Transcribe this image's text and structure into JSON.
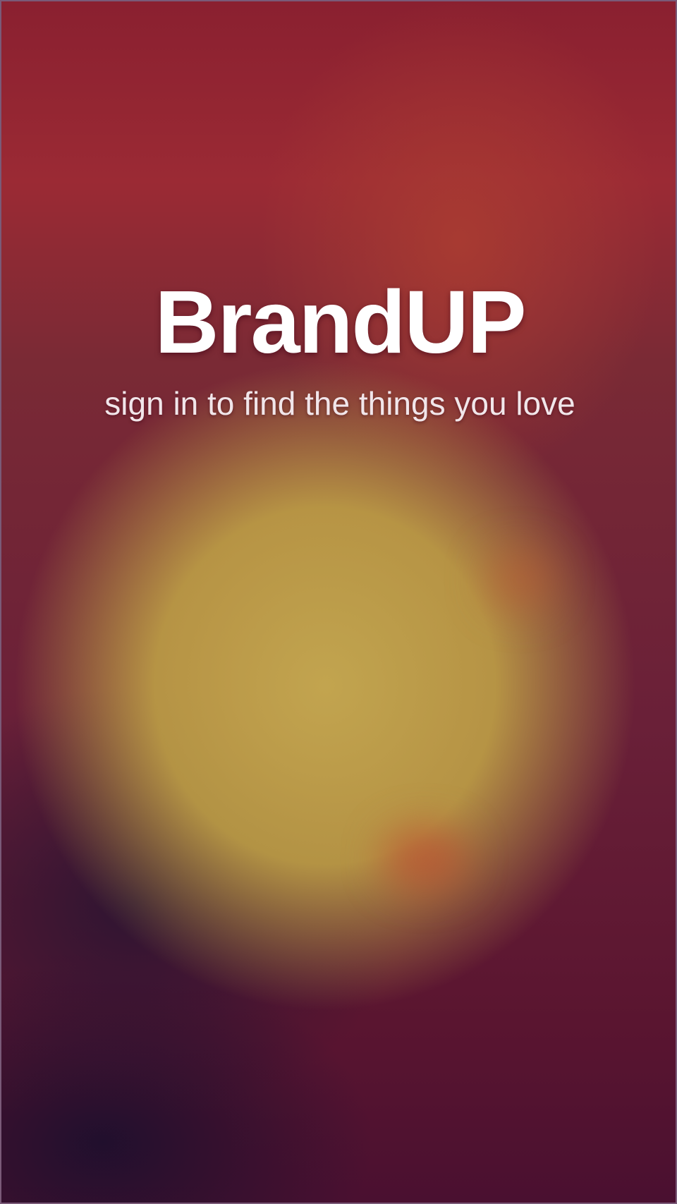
{
  "app": {
    "brand_name": "BrandUP",
    "tagline": "sign in to find the things you love"
  },
  "colors": {
    "text_primary": "#ffffff",
    "background_top": "#8a2030",
    "background_center": "#c8aa50",
    "background_bottom": "#4a1030"
  }
}
